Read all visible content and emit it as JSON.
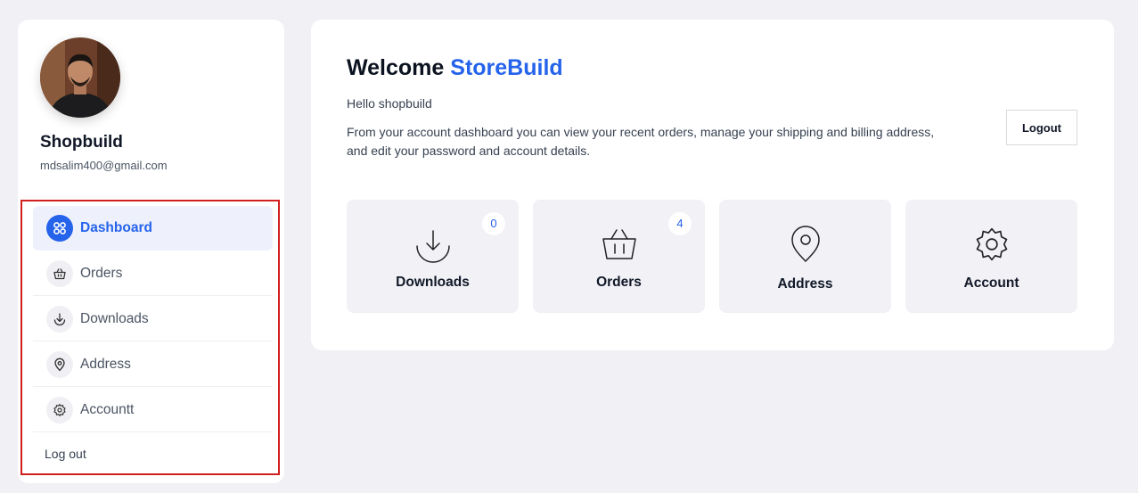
{
  "profile": {
    "name": "Shopbuild",
    "email": "mdsalim400@gmail.com"
  },
  "sidebar": {
    "items": [
      {
        "label": "Dashboard",
        "icon": "grid-icon",
        "active": true
      },
      {
        "label": "Orders",
        "icon": "basket-icon",
        "active": false
      },
      {
        "label": "Downloads",
        "icon": "download-icon",
        "active": false
      },
      {
        "label": "Address",
        "icon": "location-pin-icon",
        "active": false
      },
      {
        "label": "Accountt",
        "icon": "gear-icon",
        "active": false
      }
    ],
    "logout_label": "Log out"
  },
  "main": {
    "welcome_prefix": "Welcome",
    "welcome_brand": "StoreBuild",
    "hello": "Hello shopbuild",
    "description": "From your account dashboard you can view your recent orders, manage your shipping and billing address, and edit your password and account details.",
    "logout_button": "Logout",
    "cards": [
      {
        "label": "Downloads",
        "icon": "download-icon",
        "badge": "0"
      },
      {
        "label": "Orders",
        "icon": "basket-icon",
        "badge": "4"
      },
      {
        "label": "Address",
        "icon": "location-pin-icon"
      },
      {
        "label": "Account",
        "icon": "gear-icon"
      }
    ]
  },
  "colors": {
    "accent": "#2563eb",
    "background": "#f0f0f5",
    "card_bg": "#f1f1f6",
    "highlight_border": "#d11f1f"
  }
}
